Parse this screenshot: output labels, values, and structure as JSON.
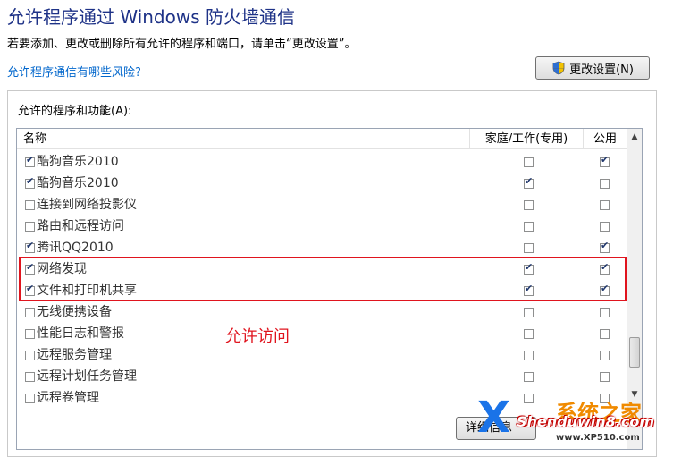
{
  "header": {
    "title": "允许程序通过 Windows 防火墙通信",
    "subtitle": "若要添加、更改或删除所有允许的程序和端口，请单击“更改设置”。",
    "risk_link": "允许程序通信有哪些风险?",
    "change_settings_label": "更改设置(N)",
    "shield_icon": "uac-shield-icon"
  },
  "programs": {
    "group_label": "允许的程序和功能(A):",
    "columns": {
      "name": "名称",
      "home_work": "家庭/工作(专用)",
      "public": "公用"
    },
    "rows": [
      {
        "name": "酷狗音乐2010",
        "enabled": true,
        "home": false,
        "public": true
      },
      {
        "name": "酷狗音乐2010",
        "enabled": true,
        "home": true,
        "public": false
      },
      {
        "name": "连接到网络投影仪",
        "enabled": false,
        "home": false,
        "public": false
      },
      {
        "name": "路由和远程访问",
        "enabled": false,
        "home": false,
        "public": false
      },
      {
        "name": "腾讯QQ2010",
        "enabled": true,
        "home": false,
        "public": true
      },
      {
        "name": "网络发现",
        "enabled": true,
        "home": true,
        "public": true
      },
      {
        "name": "文件和打印机共享",
        "enabled": true,
        "home": true,
        "public": true
      },
      {
        "name": "无线便携设备",
        "enabled": false,
        "home": false,
        "public": false
      },
      {
        "name": "性能日志和警报",
        "enabled": false,
        "home": false,
        "public": false
      },
      {
        "name": "远程服务管理",
        "enabled": false,
        "home": false,
        "public": false
      },
      {
        "name": "远程计划任务管理",
        "enabled": false,
        "home": false,
        "public": false
      },
      {
        "name": "远程卷管理",
        "enabled": false,
        "home": false,
        "public": false
      }
    ]
  },
  "annotation": {
    "text": "允许访问",
    "color": "#e0141e"
  },
  "footer": {
    "details_label": "详细信息"
  },
  "watermark": {
    "logo_letter": "X",
    "brand_cn": "系统之家",
    "site": "Shenduwin8.com",
    "sub": "www.XP510.com"
  }
}
